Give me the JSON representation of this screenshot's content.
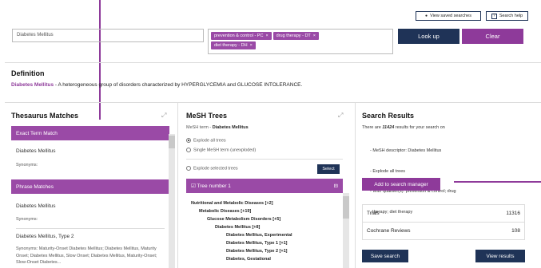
{
  "top": {
    "view_saved_label": "View saved searches",
    "search_help_label": "Search help"
  },
  "search": {
    "term_value": "Diabetes Mellitus",
    "chips": [
      {
        "label": "prevention & control - PC",
        "x": "×"
      },
      {
        "label": "drug therapy - DT",
        "x": "×"
      },
      {
        "label": "diet therapy - DH",
        "x": "×"
      }
    ],
    "lookup_label": "Look up",
    "clear_label": "Clear"
  },
  "definition": {
    "heading": "Definition",
    "term": "Diabetes Mellitus",
    "text": " - A heterogeneous group of disorders characterized by HYPERGLYCEMIA and GLUCOSE INTOLERANCE."
  },
  "thesaurus": {
    "heading": "Thesaurus Matches",
    "exact_header": "Exact Term Match",
    "exact_term": "Diabetes Mellitus",
    "exact_syn": "Synonyms:",
    "phrase_header": "Phrase Matches",
    "phrase1_term": "Diabetes Mellitus",
    "phrase1_syn": "Synonyms:",
    "phrase2_term": "Diabetes Mellitus, Type 2",
    "phrase2_syn": "Synonyms: Maturity-Onset Diabetes Mellitus; Diabetes Mellitus, Maturity Onset; Diabetes Mellitus, Slow Onset; Diabetes Mellitus, Maturity-Onset; Slow-Onset Diabetes..."
  },
  "mesh": {
    "heading": "MeSH Trees",
    "term_prefix": "MeSH term - ",
    "term": "Diabetes Mellitus",
    "explode_all": "Explode all trees",
    "single_term": "Single MeSH term (unexploded)",
    "explode_selected": "Explode selected trees",
    "select_label": "Select",
    "tree_header": "Tree number 1",
    "tree_box": "☑",
    "tree_toggle": "⊟",
    "tree": [
      "Nutritional and Metabolic Diseases [+2]",
      "Metabolic Diseases [+19]",
      "Glucose Metabolism Disorders [+5]",
      "Diabetes Mellitus [+8]",
      "Diabetes Mellitus, Experimental",
      "Diabetes Mellitus, Type 1 [+1]",
      "Diabetes Mellitus, Type 2 [+1]",
      "Diabetes, Gestational"
    ]
  },
  "results": {
    "heading": "Search Results",
    "line1_a": "There are ",
    "line1_count": "11424",
    "line1_b": " results for your search on",
    "bullets": [
      "- MeSH descriptor: Diabetes Mellitus",
      "- Explode all trees",
      "- With qualifier(s): prevention & control; drug",
      "  therapy; diet therapy"
    ],
    "add_label": "Add to search manager",
    "rows": [
      {
        "label": "Trials",
        "count": "11316"
      },
      {
        "label": "Cochrane Reviews",
        "count": "108"
      }
    ],
    "save_label": "Save search",
    "view_label": "View results"
  },
  "icons": {
    "expand": "⤢",
    "eye": "●",
    "question": "?"
  }
}
